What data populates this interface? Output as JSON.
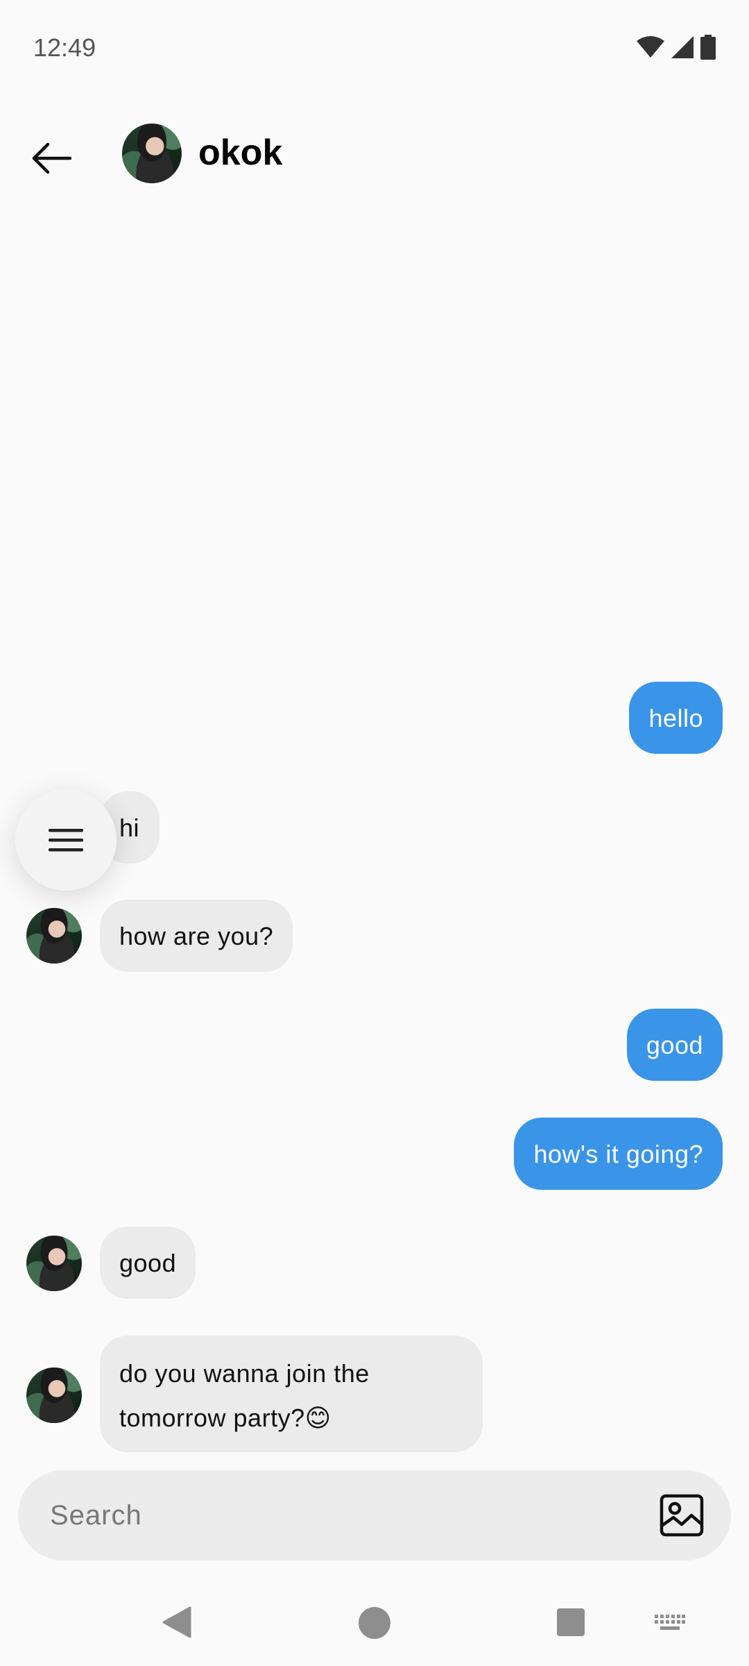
{
  "status_bar": {
    "time": "12:49",
    "icons": [
      "wifi-icon",
      "signal-icon",
      "battery-icon"
    ]
  },
  "header": {
    "title": "okok",
    "back_icon": "arrow-left-icon"
  },
  "messages": [
    {
      "side": "sent",
      "text": "hello"
    },
    {
      "side": "received",
      "text": "hi"
    },
    {
      "side": "received",
      "text": "how are you?"
    },
    {
      "side": "sent",
      "text": "good"
    },
    {
      "side": "sent",
      "text": "how's it going?"
    },
    {
      "side": "received",
      "text": "good"
    },
    {
      "side": "received",
      "text": "do you wanna join the tomorrow party?😊"
    }
  ],
  "composer": {
    "placeholder": "Search",
    "value": "",
    "image_icon": "image-icon"
  },
  "fab": {
    "icon": "menu-icon"
  },
  "nav_bar": {
    "icons": [
      "back-triangle-icon",
      "home-circle-icon",
      "recents-square-icon",
      "keyboard-icon"
    ]
  },
  "colors": {
    "sent_bubble": "#3a94e8",
    "received_bubble": "#ebebeb",
    "background": "#fafafa"
  }
}
